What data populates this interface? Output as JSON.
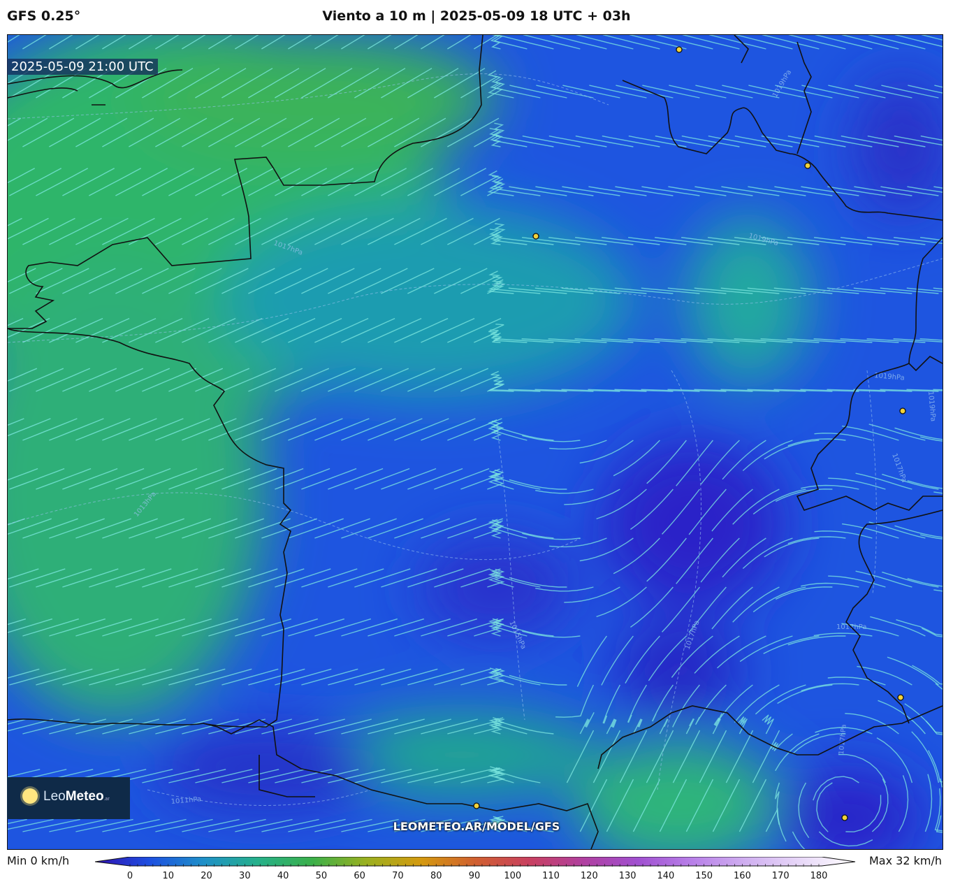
{
  "header": {
    "model": "GFS 0.25°",
    "title": "Viento a 10 m | 2025-05-09 18 UTC + 03h"
  },
  "map": {
    "valid_time": "2025-05-09 21:00 UTC",
    "isobar_labels": [
      "1017hPa",
      "1019hPa",
      "1019hPa",
      "1019hPa",
      "1019hPa",
      "1013hPa",
      "1017hPa",
      "1015hPa",
      "1017hPa",
      "1017hPa",
      "1017hPa",
      "1011hPa"
    ],
    "colors": {
      "calm": "#2a1fd0",
      "weak": "#1e5be8",
      "moderate": "#1fa8a8",
      "fresh": "#2fb56a",
      "streamline": "#7ee8e0",
      "coast": "#111111",
      "city_marker": "#f2d23a"
    },
    "city_markers": 7
  },
  "branding": {
    "logo_leo": "Leo",
    "logo_meteo": "Meteo",
    "logo_tld": ".ar",
    "site_url": "LEOMETEO.AR/MODEL/GFS"
  },
  "colorbar": {
    "min_label": "Min 0 km/h",
    "max_label": "Max 32 km/h",
    "ticks": [
      "0",
      "10",
      "20",
      "30",
      "40",
      "50",
      "60",
      "70",
      "80",
      "90",
      "100",
      "110",
      "120",
      "130",
      "140",
      "150",
      "160",
      "170",
      "180"
    ],
    "stops": [
      "#3010b0",
      "#1e4fe0",
      "#1f90c8",
      "#26b08a",
      "#3bb04a",
      "#9ab020",
      "#d49a10",
      "#d06030",
      "#c84060",
      "#b040a0",
      "#a050d0",
      "#b880e8",
      "#d0b0f0",
      "#e8d8f8",
      "#ffffff"
    ]
  }
}
